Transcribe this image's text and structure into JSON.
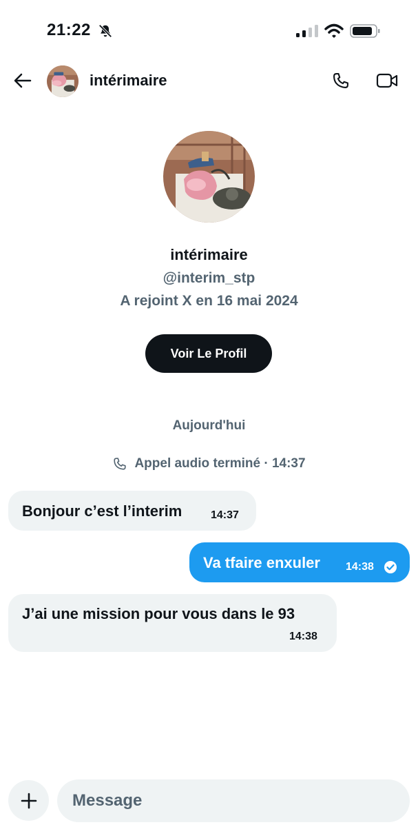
{
  "status_bar": {
    "time": "21:22",
    "icons": [
      "bell-slash-icon",
      "cellular-signal-icon",
      "wifi-icon",
      "battery-icon"
    ]
  },
  "header": {
    "back_icon": "arrow-left-icon",
    "name": "intérimaire",
    "actions": [
      "phone-icon",
      "video-camera-icon"
    ]
  },
  "profile": {
    "name": "intérimaire",
    "handle": "@interim_stp",
    "joined": "A rejoint X en 16 mai 2024",
    "button_label": "Voir Le Profil"
  },
  "conversation": {
    "day_divider": "Aujourd'hui",
    "call_event": "Appel audio terminé · 14:37",
    "messages": [
      {
        "direction": "incoming",
        "text": "Bonjour c’est l’interim",
        "time": "14:37"
      },
      {
        "direction": "outgoing",
        "text": "Va tfaire enxuler",
        "time": "14:38",
        "status": "read"
      },
      {
        "direction": "incoming",
        "text": "J’ai une mission pour vous dans le 93",
        "time": "14:38"
      }
    ]
  },
  "composer": {
    "placeholder": "Message"
  },
  "colors": {
    "accent": "#1d9bf0",
    "text_primary": "#0f1419",
    "text_secondary": "#536471",
    "bubble_incoming": "#eff3f4",
    "button_dark": "#0f1419"
  }
}
